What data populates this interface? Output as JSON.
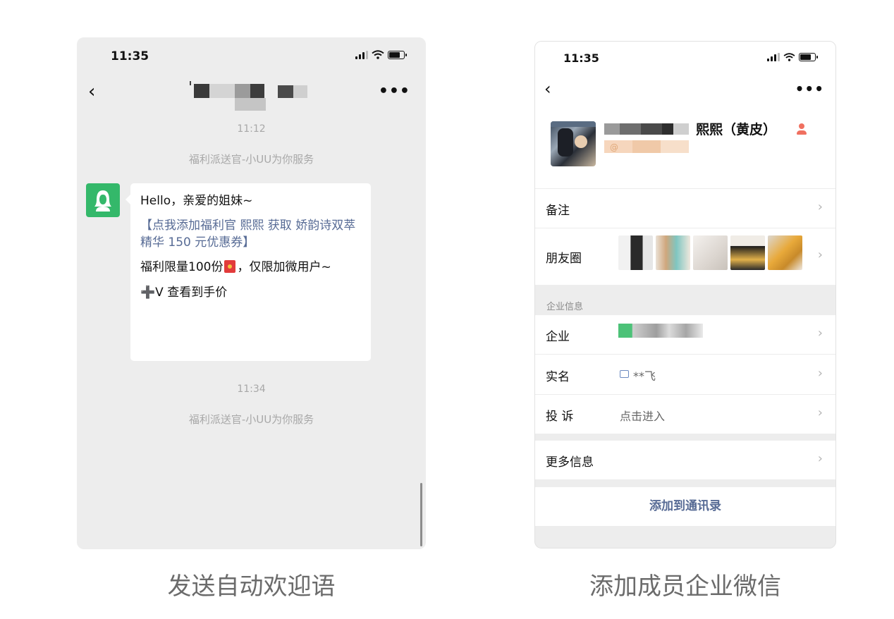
{
  "left_phone": {
    "status_time": "11:35",
    "chat_time_1": "11:12",
    "system_msg_1": "福利派送官-小UU为你服务",
    "message": {
      "line1": "Hello，亲爱的姐妹~",
      "link": "【点我添加福利官 熙熙 获取 娇韵诗双萃精华 150 元优惠券】",
      "line3_before": "福利限量100份",
      "line3_after": "，仅限加微用户~",
      "line4": "➕V 查看到手价"
    },
    "chat_time_2": "11:34",
    "system_msg_2": "福利派送官-小UU为你服务",
    "icons": [
      "back-arrow-icon",
      "more-icon",
      "signal-icon",
      "wifi-icon",
      "battery-icon",
      "red-packet-icon"
    ]
  },
  "right_phone": {
    "status_time": "11:35",
    "profile_name": "熙熙（黄皮）",
    "handle_prefix": "@",
    "rows": {
      "remark": "备注",
      "moments": "朋友圈",
      "section_title": "企业信息",
      "company": "企业",
      "realname": "实名",
      "realname_value": "**飞",
      "complaint": "投 诉",
      "complaint_value": "点击进入",
      "more_info": "更多信息"
    },
    "add_button": "添加到通讯录"
  },
  "captions": {
    "left": "发送自动欢迎语",
    "right": "添加成员企业微信"
  },
  "colors": {
    "wechat_green": "#34b86a",
    "link_blue": "#576b95",
    "chat_bg": "#ededed"
  }
}
